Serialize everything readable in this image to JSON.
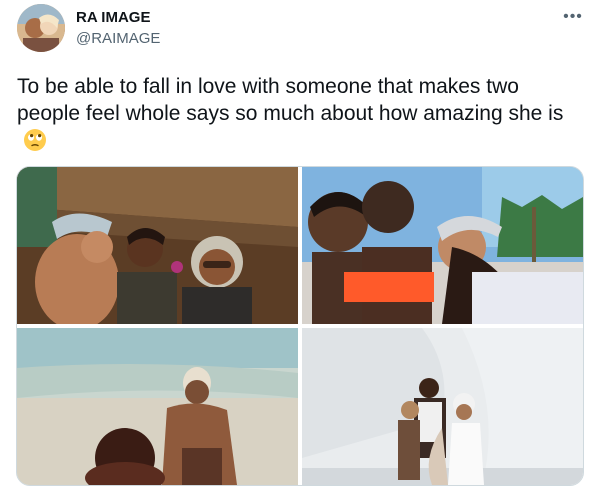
{
  "tweet": {
    "display_name": "RA IMAGE",
    "handle": "@RAIMAGE",
    "more_icon": "more-horizontal-icon",
    "more_glyph": "•••",
    "text": "To be able to fall in love with someone that makes two people feel whole says so much about how amazing she is",
    "emoji": "face-with-rolling-eyes-emoji"
  },
  "media": {
    "photo_count": 4,
    "photos": [
      {
        "scene": "group-under-thatched-roof"
      },
      {
        "scene": "group-selfie-palm-trees"
      },
      {
        "scene": "beach-shoreline"
      },
      {
        "scene": "white-wall-group"
      }
    ]
  },
  "colors": {
    "text_primary": "#0f1419",
    "text_secondary": "#536471",
    "border": "#cfd9de",
    "background": "#ffffff"
  }
}
